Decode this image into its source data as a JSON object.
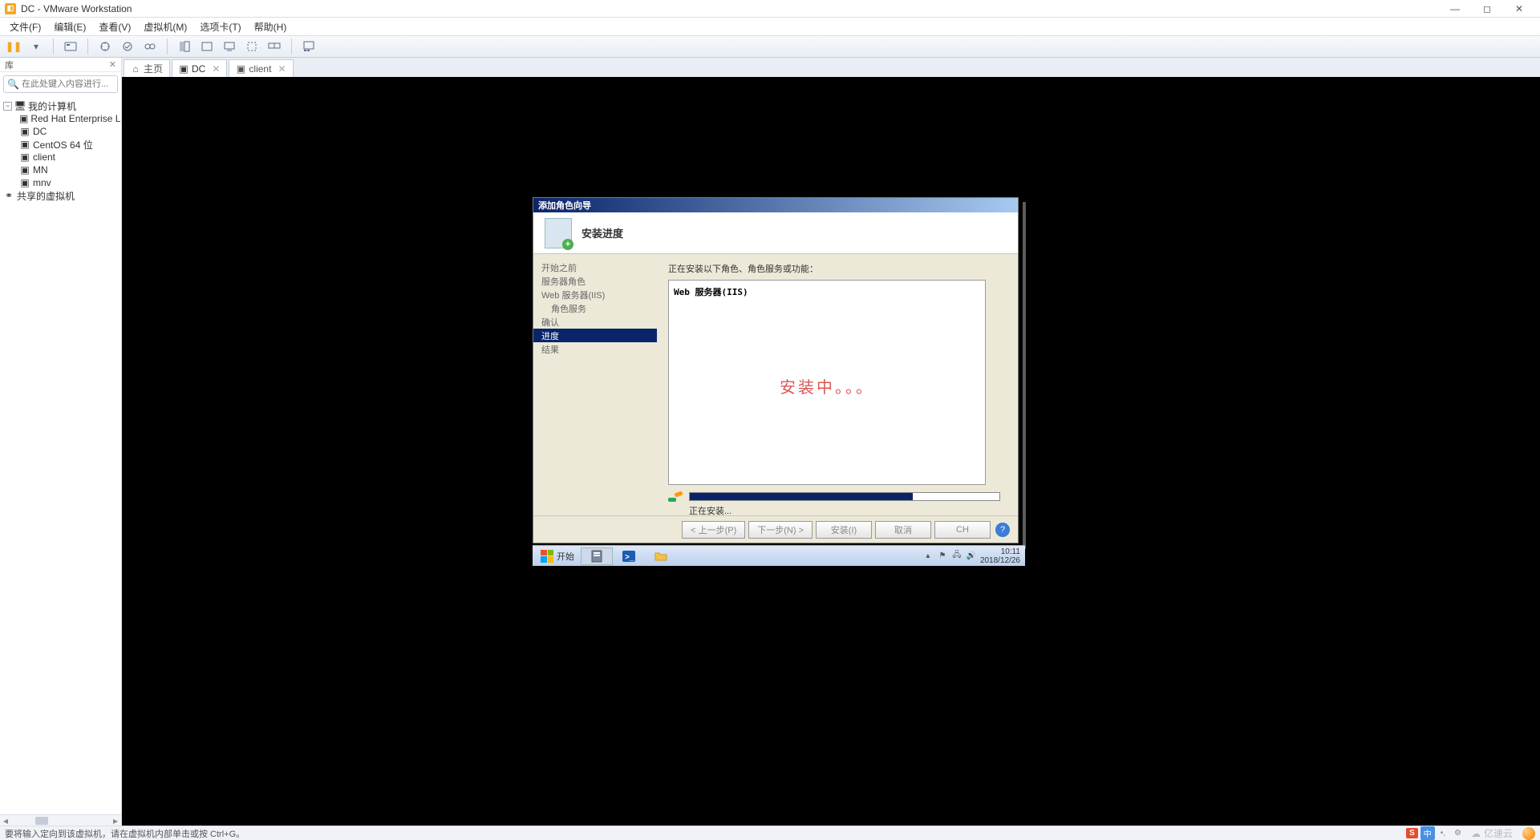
{
  "app": {
    "title": "DC - VMware Workstation"
  },
  "menu": {
    "file": "文件(F)",
    "edit": "编辑(E)",
    "view": "查看(V)",
    "vm": "虚拟机(M)",
    "tabs": "选项卡(T)",
    "help": "帮助(H)"
  },
  "sidebar": {
    "header": "库",
    "search_placeholder": "在此处键入内容进行...",
    "root": "我的计算机",
    "items": [
      "Red Hat Enterprise L",
      "DC",
      "CentOS 64 位",
      "client",
      "MN",
      "mnv"
    ],
    "shared": "共享的虚拟机"
  },
  "tabs": {
    "home": "主页",
    "dc": "DC",
    "client": "client"
  },
  "wizard": {
    "title": "添加角色向导",
    "header": "安装进度",
    "nav": {
      "before": "开始之前",
      "roles": "服务器角色",
      "iis": "Web 服务器(IIS)",
      "services": "角色服务",
      "confirm": "确认",
      "progress": "进度",
      "result": "结果"
    },
    "subtitle": "正在安装以下角色、角色服务或功能：",
    "service": "Web 服务器(IIS)",
    "annotation": "安装中。。。",
    "status": "正在安装...",
    "buttons": {
      "prev": "< 上一步(P)",
      "next": "下一步(N) >",
      "install": "安装(I)",
      "cancel": "取消",
      "lang": "CH"
    }
  },
  "guest": {
    "start": "开始",
    "time": "10:11",
    "date": "2018/12/26"
  },
  "statusbar": {
    "text": "要将输入定向到该虚拟机，请在虚拟机内部单击或按 Ctrl+G。",
    "ime_zhong": "中",
    "watermark": "亿速云"
  }
}
